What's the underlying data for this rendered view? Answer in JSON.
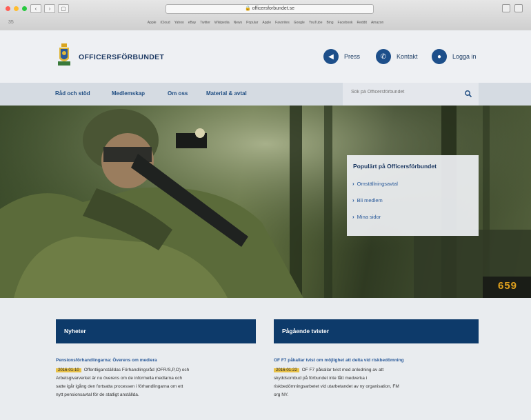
{
  "browser": {
    "url": "officersforbundet.se",
    "sidebar_label": "35",
    "bookmarks": [
      "Apple",
      "iCloud",
      "Yahoo",
      "eBay",
      "Twitter",
      "Wikipedia",
      "News",
      "Popular",
      "Apple",
      "Favorites",
      "Google",
      "YouTube",
      "Bing",
      "Facebook",
      "Reddit",
      "Amazon"
    ]
  },
  "header": {
    "logo_text": "OFFICERSFÖRBUNDET",
    "press": "Press",
    "kontakt": "Kontakt",
    "logga_in": "Logga in"
  },
  "nav": {
    "items": [
      "Råd och stöd",
      "Medlemskap",
      "Om oss",
      "Material & avtal"
    ],
    "search_placeholder": "Sök på Officersförbundet"
  },
  "popular": {
    "title": "Populärt på Officersförbundet",
    "items": [
      "Omställningsavtal",
      "Bli medlem",
      "Mina sidor"
    ]
  },
  "hero": {
    "plate": "659"
  },
  "news": {
    "header": "Nyheter",
    "title": "Pensionsförhandlingarna: Överens om mediera",
    "date": "2016-01-10",
    "lines": [
      "Offentliganställdas Förhandlingsråd (OFR/S,P,O) och",
      "Arbetsgivarverket är nu överens om de informella medlarna och",
      "satte igår igång den fortsatta processen i förhandlingarna om ett",
      "nytt pensionsavtal för de statligt anställda."
    ]
  },
  "disputes": {
    "header": "Pågående tvister",
    "title": "OF F7 påkallar tvist om möjlighet att delta vid riskbedömning",
    "date": "2016-01-22",
    "lines": [
      "OF F7 påkallar tvist med anledning av att",
      "skyddsombud på förbundet inte fått medverka i",
      "riskbedömningsarbetet vid utarbetandet av ny organisation, FM",
      "org NY."
    ]
  },
  "colors": {
    "brand_blue": "#0d3a6a",
    "accent_yellow": "#e8c148",
    "nav_bg": "#d5dbe2"
  }
}
